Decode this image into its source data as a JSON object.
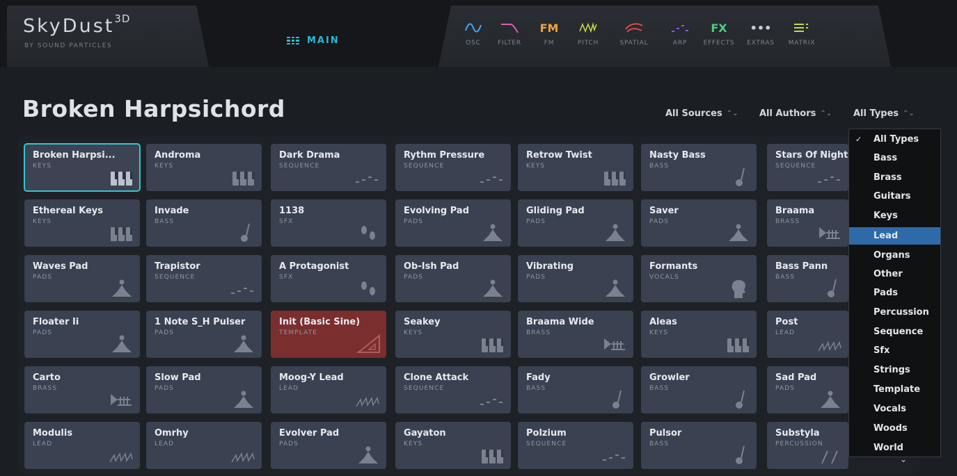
{
  "brand": {
    "name": "SkyDust",
    "superscript": "3D",
    "subtitle": "BY SOUND PARTICLES"
  },
  "main_tab": {
    "label": "MAIN",
    "color": "#2ab9d6"
  },
  "modules": [
    {
      "label": "OSC",
      "icon": "wave-icon",
      "color": "#3fa9f5"
    },
    {
      "label": "FILTER",
      "icon": "filter-icon",
      "color": "#e05ab8"
    },
    {
      "label": "FM",
      "icon": "fm-text",
      "text": "FM",
      "color": "#f0a23a"
    },
    {
      "label": "PITCH",
      "icon": "pitch-icon",
      "color": "#c8d83a"
    },
    {
      "label": "SPATIAL",
      "icon": "spatial-icon",
      "color": "#e0484a"
    },
    {
      "label": "ARP",
      "icon": "arp-icon",
      "color": "#8a5ae8"
    },
    {
      "label": "EFFECTS",
      "icon": "fx-text",
      "text": "FX",
      "color": "#48d07a"
    },
    {
      "label": "EXTRAS",
      "icon": "dots-icon",
      "text": "•••",
      "color": "#c9ccd2"
    },
    {
      "label": "MATRIX",
      "icon": "matrix-icon",
      "color": "#b9e04a"
    }
  ],
  "preset_title": "Broken Harpsichord",
  "filters": {
    "sources": "All Sources",
    "authors": "All Authors",
    "types": "All Types"
  },
  "presets": [
    [
      {
        "name": "Broken Harpsi...",
        "type": "KEYS",
        "icon": "piano-icon",
        "selected": true
      },
      {
        "name": "Androma",
        "type": "KEYS",
        "icon": "piano-icon"
      },
      {
        "name": "Dark Drama",
        "type": "SEQUENCE",
        "icon": "sequence-icon"
      },
      {
        "name": "Rythm Pressure",
        "type": "SEQUENCE",
        "icon": "sequence-icon"
      },
      {
        "name": "Retrow Twist",
        "type": "KEYS",
        "icon": "piano-icon"
      },
      {
        "name": "Nasty Bass",
        "type": "BASS",
        "icon": "bass-icon"
      },
      {
        "name": "Stars Of Night",
        "type": "SEQUENCE",
        "icon": "sequence-icon"
      }
    ],
    [
      {
        "name": "Ethereal Keys",
        "type": "KEYS",
        "icon": "piano-icon"
      },
      {
        "name": "Invade",
        "type": "BASS",
        "icon": "bass-icon"
      },
      {
        "name": "1138",
        "type": "SFX",
        "icon": "footprints-icon"
      },
      {
        "name": "Evolving Pad",
        "type": "PADS",
        "icon": "meditation-icon"
      },
      {
        "name": "Gliding Pad",
        "type": "PADS",
        "icon": "meditation-icon"
      },
      {
        "name": "Saver",
        "type": "PADS",
        "icon": "meditation-icon"
      },
      {
        "name": "Braama",
        "type": "BRASS",
        "icon": "trumpet-icon"
      }
    ],
    [
      {
        "name": "Waves Pad",
        "type": "PADS",
        "icon": "meditation-icon"
      },
      {
        "name": "Trapistor",
        "type": "SEQUENCE",
        "icon": "sequence-icon"
      },
      {
        "name": "A Protagonist",
        "type": "SFX",
        "icon": "footprints-icon"
      },
      {
        "name": "Ob-Ish Pad",
        "type": "PADS",
        "icon": "meditation-icon"
      },
      {
        "name": "Vibrating",
        "type": "PADS",
        "icon": "meditation-icon"
      },
      {
        "name": "Formants",
        "type": "VOCALS",
        "icon": "head-icon"
      },
      {
        "name": "Bass Pann",
        "type": "BASS",
        "icon": "bass-icon"
      }
    ],
    [
      {
        "name": "Floater Ii",
        "type": "PADS",
        "icon": "meditation-icon"
      },
      {
        "name": "1 Note S_H Pulser",
        "type": "PADS",
        "icon": "meditation-icon"
      },
      {
        "name": "Init (Basic Sine)",
        "type": "TEMPLATE",
        "icon": "triangle-ruler-icon",
        "template": true
      },
      {
        "name": "Seakey",
        "type": "KEYS",
        "icon": "piano-icon"
      },
      {
        "name": "Braama Wide",
        "type": "BRASS",
        "icon": "trumpet-icon"
      },
      {
        "name": "Aleas",
        "type": "KEYS",
        "icon": "piano-icon"
      },
      {
        "name": "Post",
        "type": "LEAD",
        "icon": "lead-wave-icon"
      }
    ],
    [
      {
        "name": "Carto",
        "type": "BRASS",
        "icon": "trumpet-icon"
      },
      {
        "name": "Slow Pad",
        "type": "PADS",
        "icon": "meditation-icon"
      },
      {
        "name": "Moog-Y Lead",
        "type": "LEAD",
        "icon": "lead-wave-icon"
      },
      {
        "name": "Clone Attack",
        "type": "SEQUENCE",
        "icon": "sequence-icon"
      },
      {
        "name": "Fady",
        "type": "BASS",
        "icon": "bass-icon"
      },
      {
        "name": "Growler",
        "type": "BASS",
        "icon": "bass-icon"
      },
      {
        "name": "Sad Pad",
        "type": "PADS",
        "icon": "meditation-icon"
      }
    ],
    [
      {
        "name": "Modulis",
        "type": "LEAD",
        "icon": "lead-wave-icon"
      },
      {
        "name": "Omrhy",
        "type": "LEAD",
        "icon": "lead-wave-icon"
      },
      {
        "name": "Evolver Pad",
        "type": "PADS",
        "icon": "meditation-icon"
      },
      {
        "name": "Gayaton",
        "type": "KEYS",
        "icon": "piano-icon"
      },
      {
        "name": "Polzium",
        "type": "SEQUENCE",
        "icon": "sequence-icon"
      },
      {
        "name": "Pulsor",
        "type": "BASS",
        "icon": "bass-icon"
      },
      {
        "name": "Substyla",
        "type": "PERCUSSION",
        "icon": "percussion-icon"
      }
    ]
  ],
  "type_dropdown": {
    "items": [
      "All Types",
      "Bass",
      "Brass",
      "Guitars",
      "Keys",
      "Lead",
      "Organs",
      "Other",
      "Pads",
      "Percussion",
      "Sequence",
      "Sfx",
      "Strings",
      "Template",
      "Vocals",
      "Woods",
      "World"
    ],
    "checked": "All Types",
    "highlighted": "Lead",
    "highlight_color": "#2f6aa8"
  },
  "colors": {
    "accent": "#2ab9d6",
    "card": "#3a4150",
    "template_card": "#7a2e2e",
    "selected_outline": "#38c5cf"
  }
}
